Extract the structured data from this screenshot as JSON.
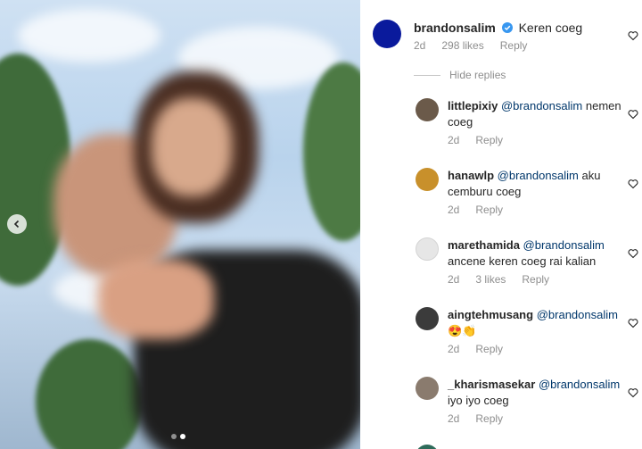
{
  "post": {
    "carousel": {
      "active_index": 1,
      "total": 2
    }
  },
  "main_comment": {
    "username": "brandonsalim",
    "text": "Keren coeg",
    "time": "2d",
    "likes": "298 likes",
    "reply_label": "Reply",
    "verified": true,
    "avatar_color": "#0a1a9c"
  },
  "hide_replies_label": "Hide replies",
  "replies": [
    {
      "username": "littlepixiy",
      "mention": "@brandonsalim",
      "text": "nemen coeg",
      "time": "2d",
      "likes": "",
      "reply_label": "Reply",
      "avatar_color": "#6b5a4a"
    },
    {
      "username": "hanawlp",
      "mention": "@brandonsalim",
      "text": "aku cemburu coeg",
      "time": "2d",
      "likes": "",
      "reply_label": "Reply",
      "avatar_color": "#c8902b"
    },
    {
      "username": "marethamida",
      "mention": "@brandonsalim",
      "text": "ancene keren coeg rai kalian",
      "time": "2d",
      "likes": "3 likes",
      "reply_label": "Reply",
      "avatar_color": "#e6e6e6"
    },
    {
      "username": "aingtehmusang",
      "mention": "@brandonsalim",
      "text": "😍👏",
      "time": "2d",
      "likes": "",
      "reply_label": "Reply",
      "avatar_color": "#3b3b3b"
    },
    {
      "username": "_kharismasekar",
      "mention": "@brandonsalim",
      "text": "iyo iyo coeg",
      "time": "2d",
      "likes": "",
      "reply_label": "Reply",
      "avatar_color": "#8a7b6e"
    }
  ],
  "colors": {
    "accent_blue": "#3897f0",
    "mention": "#00376b",
    "muted": "#8e8e8e"
  },
  "icons": {
    "heart": "heart-outline-icon",
    "verified": "verified-badge-icon",
    "prev": "chevron-left-icon"
  }
}
